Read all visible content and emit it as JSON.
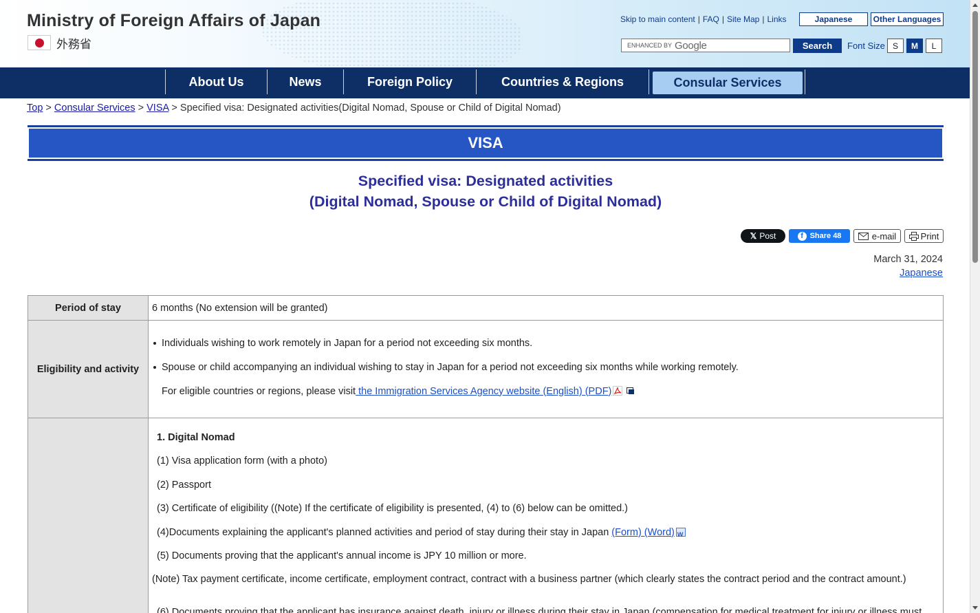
{
  "header": {
    "title": "Ministry of Foreign Affairs of Japan",
    "title_jp": "外務省",
    "util_links": [
      "Skip to main content",
      "FAQ",
      "Site Map",
      "Links"
    ],
    "lang_japanese": "Japanese",
    "lang_other": "Other Languages",
    "search_enhanced": "ENHANCED BY",
    "search_google": "Google",
    "search_button": "Search",
    "font_size_label": "Font Size",
    "font_sizes": [
      "S",
      "M",
      "L"
    ],
    "font_size_selected": "M"
  },
  "nav": {
    "items": [
      "About Us",
      "News",
      "Foreign Policy",
      "Countries & Regions",
      "Consular Services"
    ],
    "active": "Consular Services"
  },
  "breadcrumb": {
    "top": "Top",
    "consular": "Consular Services",
    "visa": "VISA",
    "current": "Specified visa: Designated activities(Digital Nomad, Spouse or Child of Digital Nomad)"
  },
  "banner": "VISA",
  "page_title": {
    "line1": "Specified visa: Designated activities",
    "line2": "(Digital Nomad, Spouse or Child of Digital Nomad)"
  },
  "share": {
    "x_post": "Post",
    "fb_share": "Share 48",
    "email": "e-mail",
    "print": "Print"
  },
  "date": "March 31, 2024",
  "japanese_link": "Japanese",
  "table": {
    "period_label": "Period of stay",
    "period_value": "6 months (No extension will be granted)",
    "eligibility_label": "Eligibility and activity",
    "eligibility_bullets": [
      "Individuals wishing to work remotely in Japan for a period not exceeding six months.",
      "Spouse or child accompanying an individual wishing to stay in Japan for a period not exceeding six months while working remotely."
    ],
    "visit_text": "For eligible countries or regions, please visit",
    "visit_link": " the Immigration Services Agency website (English) (PDF)",
    "docs_heading": "1. Digital Nomad",
    "docs": [
      "(1) Visa application form (with a photo)",
      "(2) Passport",
      "(3) Certificate of eligibility ((Note) If the certificate of eligibility is presented, (4) to (6) below can be omitted.)"
    ],
    "doc4_text": "(4)Documents explaining the applicant's planned activities and period of stay during their stay in Japan ",
    "doc4_link": "(Form) (Word)",
    "doc5": "(5) Documents proving that the applicant's annual income is JPY 10 million or more.",
    "doc5_note": "(Note) Tax payment certificate, income certificate, employment contract, contract with a business partner (which clearly states the contract period and the contract amount.)",
    "doc6": "(6) Documents proving that the applicant has insurance against death, injury or illness during their stay in Japan (compensation for medical treatment for injury or illness must"
  }
}
